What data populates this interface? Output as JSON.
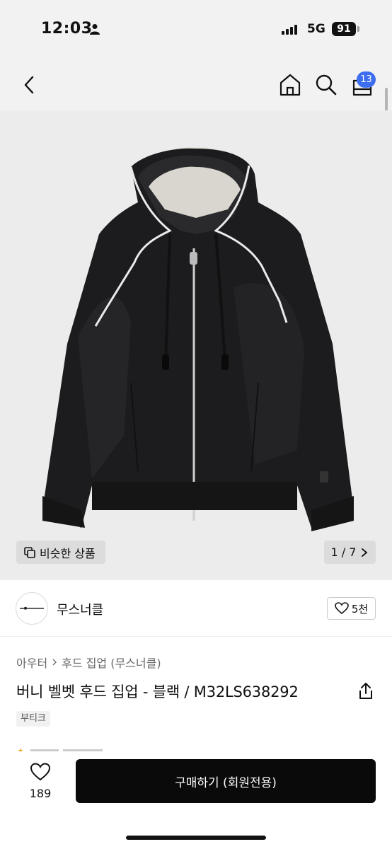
{
  "status_bar": {
    "time": "12:03",
    "network": "5G",
    "battery": "91"
  },
  "nav": {
    "cart_count": "13"
  },
  "gallery": {
    "similar_label": "비슷한 상품",
    "page_indicator": "1 / 7"
  },
  "seller": {
    "name": "무스너클",
    "like_count": "5천"
  },
  "breadcrumb": {
    "items": [
      "아우터",
      "후드 집업 (무스너클)"
    ]
  },
  "product": {
    "title": "버니 벨벳 후드 집업 - 블랙 / M32LS638292",
    "tag": "부티크"
  },
  "bottom_bar": {
    "wish_count": "189",
    "buy_label": "구매하기 (회원전용)"
  },
  "colors": {
    "accent_badge": "#3d6ef0",
    "buy_button": "#0a0a0a"
  }
}
